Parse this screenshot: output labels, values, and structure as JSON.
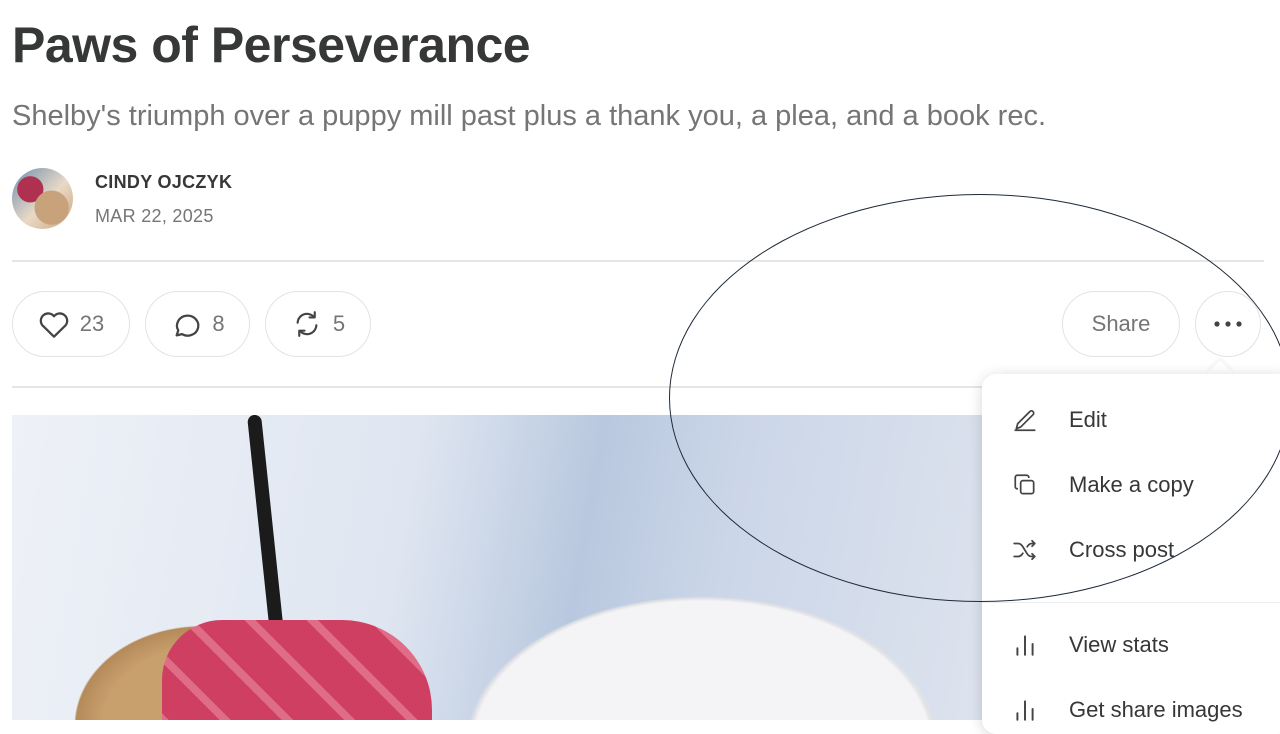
{
  "post": {
    "title": "Paws of Perseverance",
    "subtitle": "Shelby's triumph over a puppy mill past plus a thank you, a plea, and a book rec.",
    "author": "CINDY OJCZYK",
    "date": "MAR 22, 2025"
  },
  "actions": {
    "likes": "23",
    "comments": "8",
    "restacks": "5",
    "share_label": "Share",
    "like_icon": "heart-icon",
    "comment_icon": "comment-icon",
    "restack_icon": "restack-icon",
    "more_icon": "more-icon"
  },
  "menu": {
    "items": [
      {
        "label": "Edit",
        "icon": "pencil-icon"
      },
      {
        "label": "Make a copy",
        "icon": "copy-icon"
      },
      {
        "label": "Cross post",
        "icon": "shuffle-icon"
      },
      {
        "label": "View stats",
        "icon": "bar-chart-icon"
      },
      {
        "label": "Get share images",
        "icon": "bar-chart-icon"
      }
    ]
  },
  "colors": {
    "text": "#363737",
    "muted": "#757575",
    "border": "#e3e3e3",
    "annotation": "#1e2b3a"
  }
}
